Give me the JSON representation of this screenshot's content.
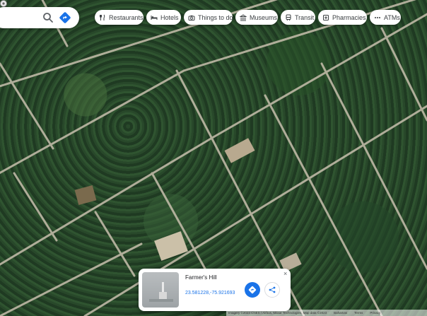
{
  "search": {
    "placeholder": ""
  },
  "categories": [
    {
      "label": "Restaurants",
      "icon": "fork-knife-icon"
    },
    {
      "label": "Hotels",
      "icon": "bed-icon"
    },
    {
      "label": "Things to do",
      "icon": "camera-icon"
    },
    {
      "label": "Museums",
      "icon": "museum-icon"
    },
    {
      "label": "Transit",
      "icon": "train-icon"
    },
    {
      "label": "Pharmacies",
      "icon": "pharmacy-icon"
    },
    {
      "label": "ATMs",
      "icon": "more-icon"
    }
  ],
  "place_card": {
    "title": "Farmer's Hill",
    "coordinates": "23.581228,-75.921693",
    "close_label": "×"
  },
  "attribution": {
    "text": "Imagery ©2023 CNES / Airbus, Maxar Technologies, Map data ©2023",
    "links": [
      "Bahamas",
      "Terms",
      "Privacy"
    ]
  },
  "colors": {
    "accent": "#1a73e8",
    "card_bg": "#ffffff",
    "road": "#c9c3b0"
  }
}
